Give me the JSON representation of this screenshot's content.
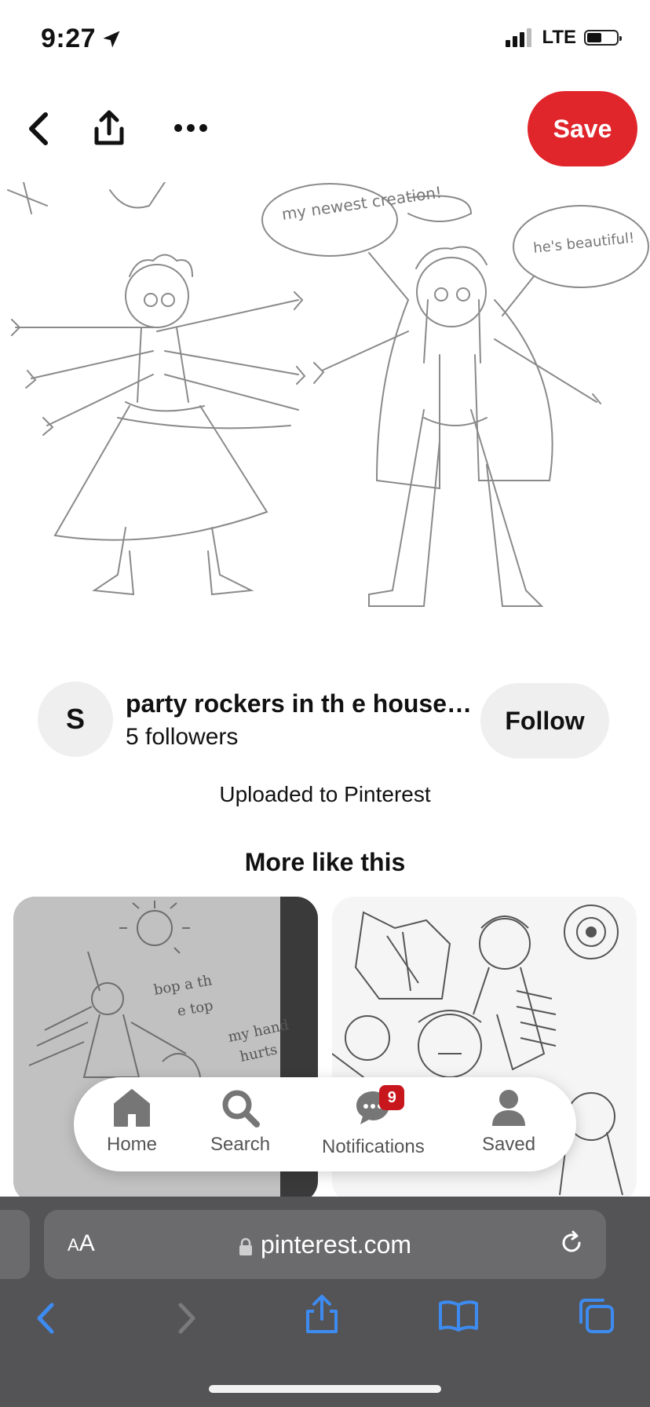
{
  "status_bar": {
    "time": "9:27",
    "network": "LTE"
  },
  "pin": {
    "save_label": "Save"
  },
  "sketch": {
    "bubble_left": "my newest creation!",
    "bubble_right": "he's beautiful!"
  },
  "creator": {
    "avatar_letter": "S",
    "name": "party rockers in th e house…",
    "followers": "5 followers",
    "follow_label": "Follow"
  },
  "upload_source": "Uploaded to Pinterest",
  "more_section": {
    "title": "More like this"
  },
  "grid_cards": [
    {
      "text_line1": "bop a th",
      "text_line2": "e top",
      "text_line3": "my hand",
      "text_line4": "hurts"
    }
  ],
  "bottom_nav": {
    "home": "Home",
    "search": "Search",
    "notifications": "Notifications",
    "notifications_count": "9",
    "saved": "Saved"
  },
  "browser": {
    "aa": "AA",
    "url": "pinterest.com"
  },
  "colors": {
    "brand_red": "#e0252b",
    "badge_red": "#c8161d",
    "safari_blue": "#3d8bf0"
  }
}
